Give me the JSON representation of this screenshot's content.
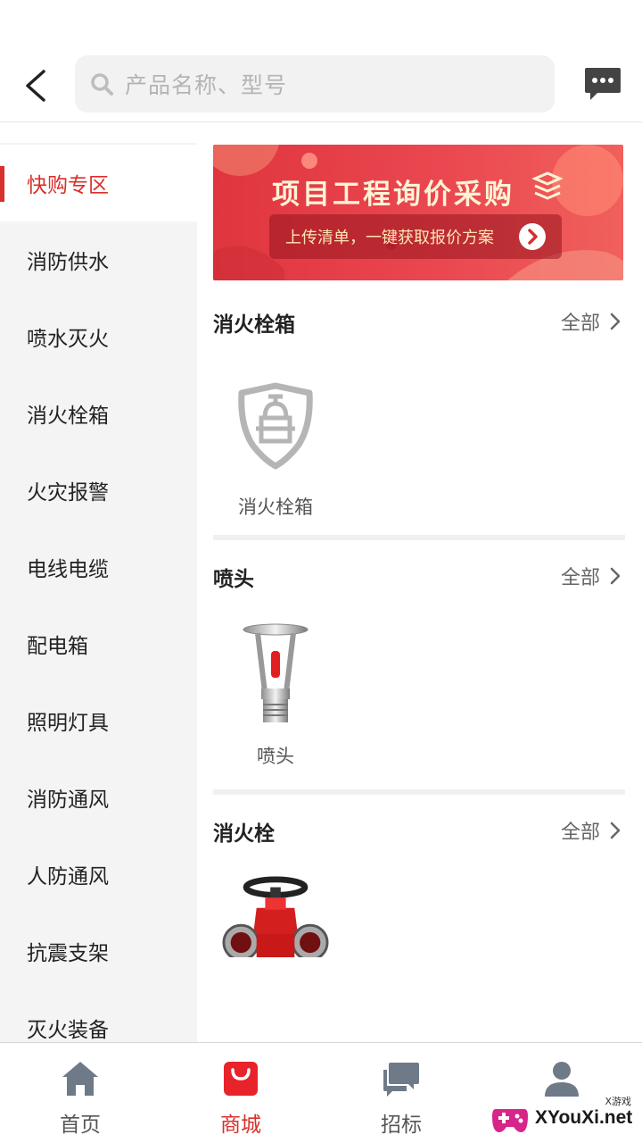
{
  "header": {
    "search_placeholder": "产品名称、型号"
  },
  "sidebar": {
    "items": [
      {
        "label": "快购专区",
        "active": true
      },
      {
        "label": "消防供水"
      },
      {
        "label": "喷水灭火"
      },
      {
        "label": "消火栓箱"
      },
      {
        "label": "火灾报警"
      },
      {
        "label": "电线电缆"
      },
      {
        "label": "配电箱"
      },
      {
        "label": "照明灯具"
      },
      {
        "label": "消防通风"
      },
      {
        "label": "人防通风"
      },
      {
        "label": "抗震支架"
      },
      {
        "label": "灭火装备"
      }
    ]
  },
  "banner": {
    "title": "项目工程询价采购",
    "subtitle": "上传清单，一键获取报价方案"
  },
  "sections": [
    {
      "title": "消火栓箱",
      "all_label": "全部",
      "products": [
        {
          "name": "消火栓箱"
        }
      ]
    },
    {
      "title": "喷头",
      "all_label": "全部",
      "products": [
        {
          "name": "喷头"
        }
      ]
    },
    {
      "title": "消火栓",
      "all_label": "全部",
      "products": [
        {
          "name": ""
        }
      ]
    }
  ],
  "bottom_nav": {
    "items": [
      {
        "label": "首页",
        "icon": "home-icon"
      },
      {
        "label": "商城",
        "icon": "shop-bag-icon",
        "active": true
      },
      {
        "label": "招标",
        "icon": "chat-bubbles-icon"
      },
      {
        "label": "",
        "icon": "user-icon"
      }
    ]
  },
  "watermark": {
    "text": "XYouXi.net",
    "small_text": "X游戏"
  },
  "colors": {
    "accent": "#d8302c",
    "banner": "#e63c45",
    "sidebar_bg": "#f4f4f4"
  }
}
